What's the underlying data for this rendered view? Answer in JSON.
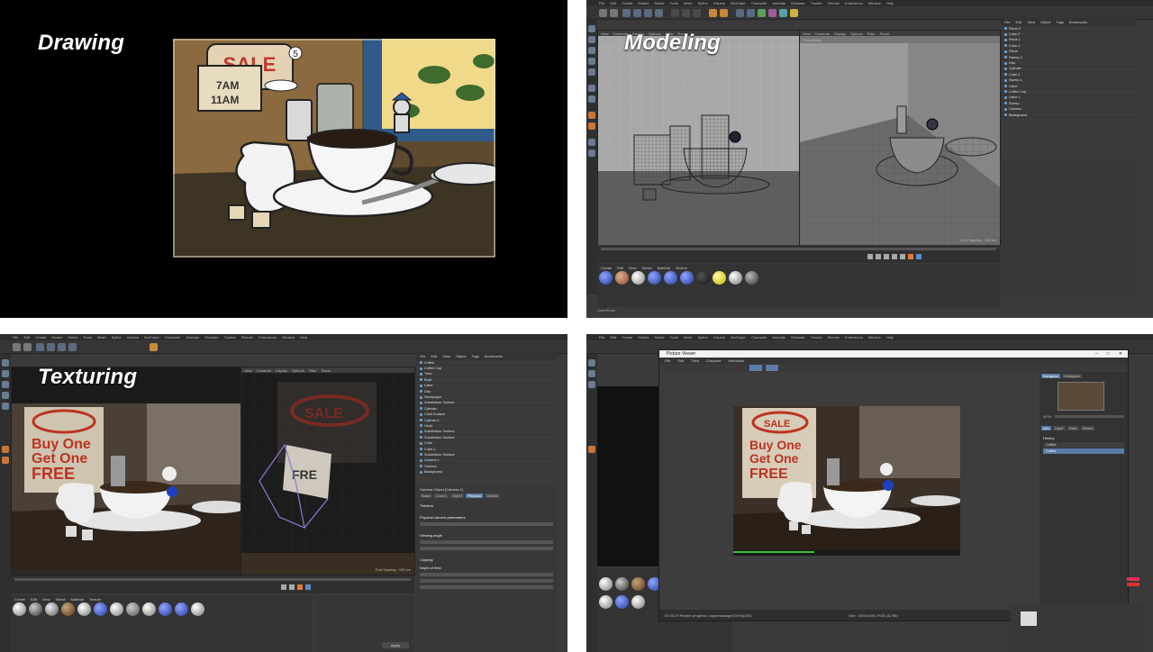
{
  "stages": {
    "drawing": {
      "label": "Drawing"
    },
    "modeling": {
      "label": "Modeling"
    },
    "texturing": {
      "label": "Texturing"
    }
  },
  "drawing_art": {
    "sign_text": "SALE",
    "hours_top": "7AM",
    "hours_bottom": "11AM",
    "number": "5"
  },
  "c4d": {
    "menu": [
      "File",
      "Edit",
      "Create",
      "Modes",
      "Select",
      "Tools",
      "Mesh",
      "Spline",
      "Volume",
      "MoGraph",
      "Character",
      "Animate",
      "Simulate",
      "Tracker",
      "Render",
      "Extensions",
      "Window",
      "Help"
    ],
    "viewport_menu": [
      "View",
      "Cameras",
      "Display",
      "Options",
      "Filter",
      "Panel"
    ],
    "perspective": "Perspective",
    "grid_spacing": "Grid Spacing : 100 cm",
    "obj_tabs": [
      "File",
      "Edit",
      "View",
      "Object",
      "Tags",
      "Bookmarks"
    ],
    "objects_modeling": [
      "Plane.2",
      "Cube.2",
      "Plane.1",
      "Cube.1",
      "Plane",
      "Sweep.2",
      "Disc",
      "Cylinder",
      "Cube.3",
      "Sweep.1",
      "Lathe",
      "Coffee Cup",
      "Lathe.1",
      "Sweep",
      "Camera",
      "Background"
    ],
    "objects_texturing": [
      "Coffee",
      "Coffee Cup",
      "Tube",
      "Bowl",
      "Lathe",
      "Disc",
      "Newspaper",
      "Subdivision Surface",
      "Cylinder",
      "Cloth Surface",
      "Cylinder.1",
      "Head",
      "Subdivision Surface",
      "Subdivision Surface",
      "Cube",
      "Cube.1",
      "Subdivision Surface",
      "Camera.1",
      "Camera",
      "Background"
    ],
    "mat_menu": [
      "Create",
      "Edit",
      "View",
      "Select",
      "Material",
      "Texture"
    ],
    "status": "Undo/Redo"
  },
  "texturing_ui": {
    "camera_title": "Camera Object [Camera.1]",
    "cam_tabs": [
      "Basic",
      "Coord.",
      "Object",
      "Physical",
      "Details",
      "Stereoscopic",
      "Composition",
      "Spherical"
    ],
    "sections": [
      "Thinlens",
      "Physical camera parameters",
      "Viewing angle",
      "Clipping",
      "Depth of field"
    ],
    "apply": "Apply"
  },
  "picture_viewer": {
    "title": "Picture Viewer",
    "menu": [
      "File",
      "Edit",
      "View",
      "Compare",
      "Animation"
    ],
    "tabs": [
      "Navigator",
      "Histogram"
    ],
    "info_tabs": [
      "Info",
      "Layer",
      "Filter",
      "Stereo"
    ],
    "history_label": "History",
    "history_rows": [
      "Coffee",
      "Coffee"
    ],
    "zoom": "40 %",
    "status": "00:00:29  Render progress: copy/massage(100%)(100)",
    "size_info": "Size: 1920x1080, RGB (32 Bit)",
    "sign_text": "SALE",
    "poster_text": "Buy One Get One FREE"
  },
  "colors": {
    "panel_bg": "#000000",
    "ui_bg": "#3a3a3a",
    "accent_blue": "#5a7ca6"
  }
}
